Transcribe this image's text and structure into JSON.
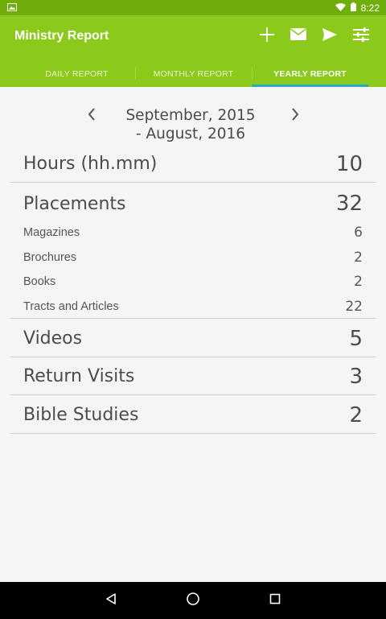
{
  "status": {
    "time": "8:22"
  },
  "app": {
    "title": "Ministry Report",
    "actions": [
      {
        "icon": "add-icon"
      },
      {
        "icon": "mail-icon"
      },
      {
        "icon": "send-icon"
      },
      {
        "icon": "settings-sliders-icon"
      }
    ]
  },
  "tabs": [
    {
      "label": "DAILY REPORT",
      "active": false
    },
    {
      "label": "MONTHLY REPORT",
      "active": false
    },
    {
      "label": "YEARLY REPORT",
      "active": true
    }
  ],
  "period": {
    "line1": "September, 2015",
    "line2": "- August, 2016"
  },
  "report": {
    "hours": {
      "label": "Hours (hh.mm)",
      "value": "10"
    },
    "placements": {
      "label": "Placements",
      "value": "32"
    },
    "magazines": {
      "label": "Magazines",
      "value": "6"
    },
    "brochures": {
      "label": "Brochures",
      "value": "2"
    },
    "books": {
      "label": "Books",
      "value": "2"
    },
    "tracts": {
      "label": "Tracts and Articles",
      "value": "22"
    },
    "videos": {
      "label": "Videos",
      "value": "5"
    },
    "return_visits": {
      "label": "Return Visits",
      "value": "3"
    },
    "bible_studies": {
      "label": "Bible Studies",
      "value": "2"
    }
  },
  "colors": {
    "accent": "#8bc91a",
    "status_bar": "#6fae0a",
    "tab_indicator": "#2aa7c4"
  }
}
